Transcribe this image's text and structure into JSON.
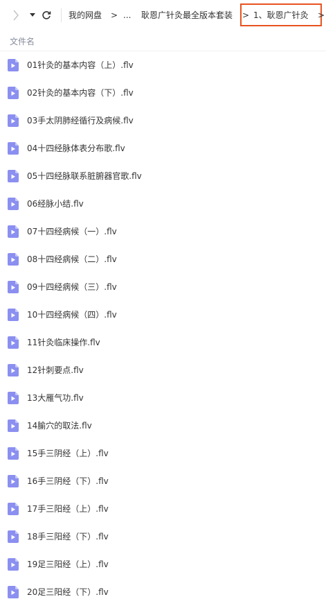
{
  "toolbar": {
    "breadcrumbs": [
      {
        "label": "我的网盘"
      },
      {
        "label": "..."
      },
      {
        "label": "耿恩广针灸最全版本套装"
      },
      {
        "label": "1、耿恩广针灸"
      }
    ],
    "separator": ">"
  },
  "header": {
    "column_name": "文件名"
  },
  "colors": {
    "highlight_border": "#e8521f",
    "video_icon": "#8b8ff0"
  },
  "files": [
    {
      "name": "01针灸的基本内容（上）.flv",
      "icon": "video-file-icon"
    },
    {
      "name": "02针灸的基本内容（下）.flv",
      "icon": "video-file-icon"
    },
    {
      "name": "03手太阴肺经循行及病候.flv",
      "icon": "video-file-icon"
    },
    {
      "name": "04十四经脉体表分布歌.flv",
      "icon": "video-file-icon"
    },
    {
      "name": "05十四经脉联系脏腑器官歌.flv",
      "icon": "video-file-icon"
    },
    {
      "name": "06经脉小结.flv",
      "icon": "video-file-icon"
    },
    {
      "name": "07十四经病候（一）.flv",
      "icon": "video-file-icon"
    },
    {
      "name": "08十四经病候（二）.flv",
      "icon": "video-file-icon"
    },
    {
      "name": "09十四经病候（三）.flv",
      "icon": "video-file-icon"
    },
    {
      "name": "10十四经病候（四）.flv",
      "icon": "video-file-icon"
    },
    {
      "name": "11针灸临床操作.flv",
      "icon": "video-file-icon"
    },
    {
      "name": "12针刺要点.flv",
      "icon": "video-file-icon"
    },
    {
      "name": "13大雁气功.flv",
      "icon": "video-file-icon"
    },
    {
      "name": "14腧穴的取法.flv",
      "icon": "video-file-icon"
    },
    {
      "name": "15手三阴经（上）.flv",
      "icon": "video-file-icon"
    },
    {
      "name": "16手三阴经（下）.flv",
      "icon": "video-file-icon"
    },
    {
      "name": "17手三阳经（上）.flv",
      "icon": "video-file-icon"
    },
    {
      "name": "18手三阳经（下）.flv",
      "icon": "video-file-icon"
    },
    {
      "name": "19足三阳经（上）.flv",
      "icon": "video-file-icon"
    },
    {
      "name": "20足三阳经（下）.flv",
      "icon": "video-file-icon"
    }
  ]
}
